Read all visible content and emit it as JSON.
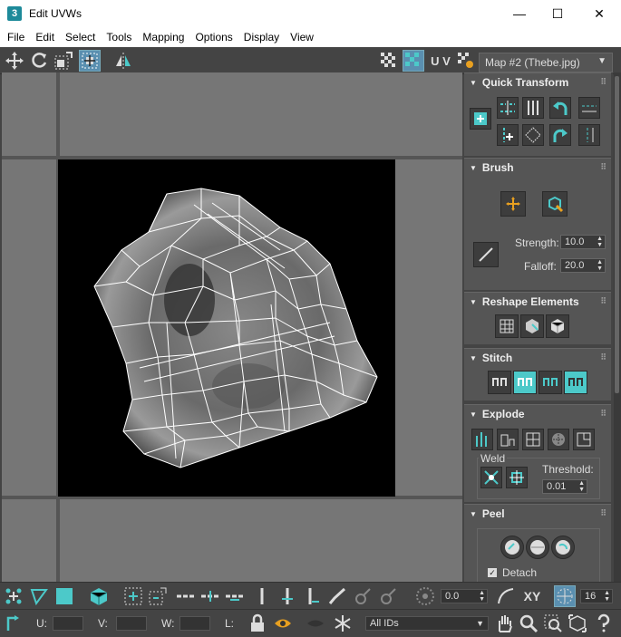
{
  "window": {
    "title": "Edit UVWs",
    "app_icon": "3",
    "minimize": "—",
    "maximize": "☐",
    "close": "✕"
  },
  "menu": [
    "File",
    "Edit",
    "Select",
    "Tools",
    "Mapping",
    "Options",
    "Display",
    "View"
  ],
  "toolbar": {
    "uv_label": "U V",
    "map_select": "Map #2 (Thebe.jpg)"
  },
  "rollouts": {
    "quick_transform": "Quick Transform",
    "brush": "Brush",
    "brush_strength_label": "Strength:",
    "brush_strength": "10.0",
    "brush_falloff_label": "Falloff:",
    "brush_falloff": "20.0",
    "reshape": "Reshape Elements",
    "stitch": "Stitch",
    "explode": "Explode",
    "weld_label": "Weld",
    "threshold_label": "Threshold:",
    "threshold": "0.01",
    "peel": "Peel",
    "detach_label": "Detach"
  },
  "bottom_toolbar": {
    "angle": "0.0",
    "xy_label": "XY",
    "grid_value": "16"
  },
  "status": {
    "u_label": "U:",
    "v_label": "V:",
    "w_label": "W:",
    "l_label": "L:",
    "ids": "All IDs"
  },
  "colors": {
    "accent": "#4cc9c9",
    "active": "#5a8fb0"
  }
}
